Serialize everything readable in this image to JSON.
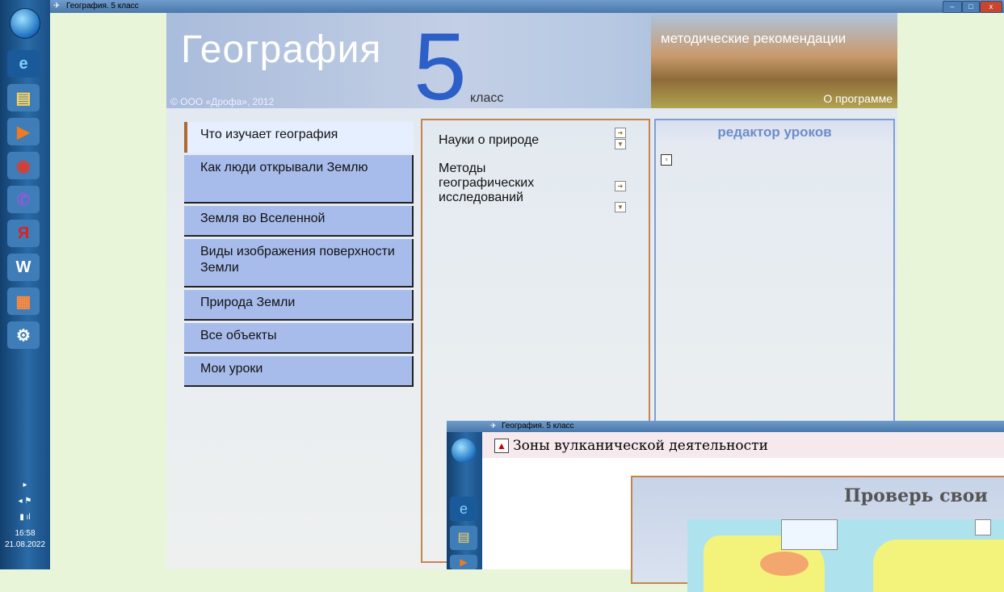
{
  "window": {
    "title": "География. 5 класс",
    "controls": [
      "–",
      "□",
      "x"
    ]
  },
  "taskbar": {
    "icons": [
      "windows-start-icon",
      "internet-explorer-icon",
      "file-explorer-icon",
      "media-player-icon",
      "chrome-icon",
      "viber-icon",
      "yandex-browser-icon",
      "word-icon",
      "presentation-icon",
      "app-icon"
    ],
    "time": "16:58",
    "date": "21.08.2022"
  },
  "header": {
    "app_title": "География",
    "grade_number": "5",
    "grade_word": "класс",
    "copyright": "© ООО «Дрофа», 2012",
    "methodic": "методические рекомендации",
    "about": "О программе"
  },
  "menu": {
    "items": [
      {
        "label": "Что изучает география"
      },
      {
        "label": "Как люди открывали Землю"
      },
      {
        "label": "Земля во Вселенной"
      },
      {
        "label": "Виды изображения поверхности Земли"
      },
      {
        "label": "Природа Земли"
      },
      {
        "label": "Все объекты"
      },
      {
        "label": "Мои уроки"
      }
    ]
  },
  "topics": {
    "items": [
      {
        "label": "Науки о природе"
      },
      {
        "label": "Методы географических исследований"
      }
    ]
  },
  "editor": {
    "title": "редактор уроков"
  },
  "overlay": {
    "window_title": "География. 5 класс",
    "lesson_title": "Зоны вулканической деятельности",
    "quiz_title": "Проверь свои"
  },
  "colors": {
    "accent_blue": "#2c5fc7",
    "menu_bg": "#a8bcec",
    "border_brown": "#c6844c"
  }
}
